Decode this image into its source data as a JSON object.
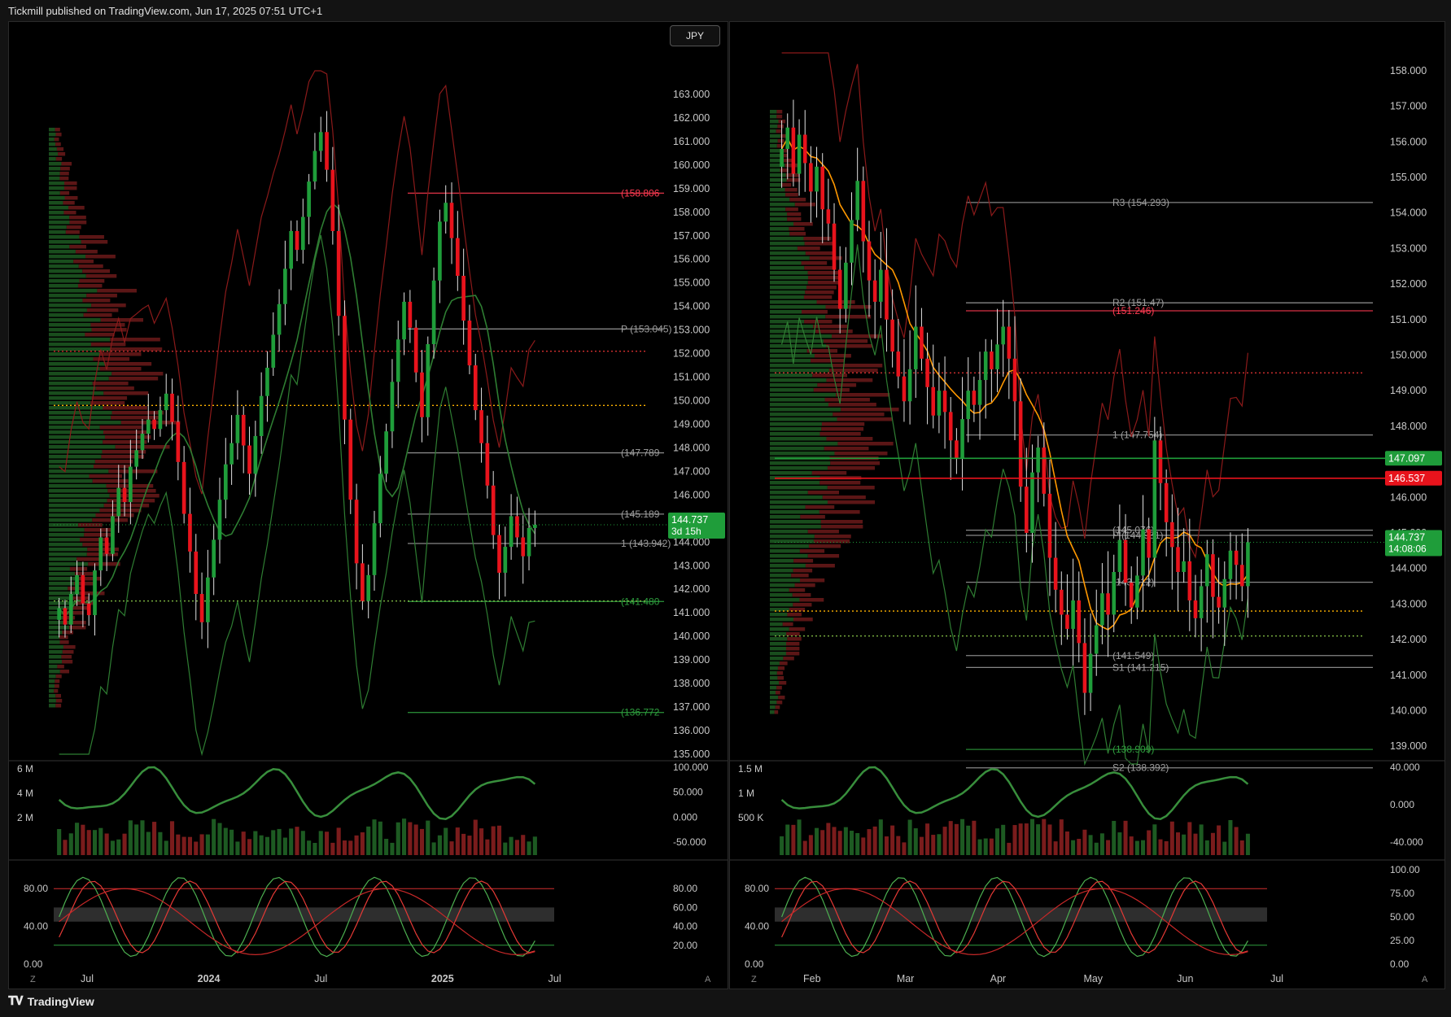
{
  "header": {
    "publisher": "Tickmill published on TradingView.com, Jun 17, 2025 07:51 UTC+1"
  },
  "footer": {
    "brand": "TradingView",
    "logo": "tradingview-logo-icon"
  },
  "colors": {
    "bull": "#1f9d3a",
    "bear": "#e8131c",
    "bg": "#000000",
    "grid_text": "#c8c8c8",
    "orange": "#ff9800"
  },
  "chart_data": [
    {
      "type": "candlestick",
      "panel": "left",
      "symbol_badge": "JPY",
      "price_axis": [
        "163.000",
        "162.000",
        "161.000",
        "160.000",
        "159.000",
        "158.000",
        "157.000",
        "156.000",
        "155.000",
        "154.000",
        "153.000",
        "152.000",
        "151.000",
        "150.000",
        "149.000",
        "148.000",
        "147.000",
        "146.000",
        "145.000",
        "144.000",
        "143.000",
        "142.000",
        "141.000",
        "140.000",
        "139.000",
        "138.000",
        "137.000",
        "136.000",
        "135.000"
      ],
      "ylim": [
        135,
        164
      ],
      "time_axis": [
        "Jul",
        "2024",
        "Jul",
        "2025",
        "Jul"
      ],
      "current_price": "144.737",
      "countdown": "3d 15h",
      "level_labels": [
        {
          "text": "(158.806",
          "value": 158.806,
          "color": "#ff3b52"
        },
        {
          "text": "P (153.045)",
          "value": 153.045,
          "color": "#9e9e9e"
        },
        {
          "text": "(147.789",
          "value": 147.789,
          "color": "#9e9e9e"
        },
        {
          "text": "(145.189",
          "value": 145.189,
          "color": "#9e9e9e"
        },
        {
          "text": "1 (143.942)",
          "value": 143.942,
          "color": "#9e9e9e"
        },
        {
          "text": "(141.480",
          "value": 141.48,
          "color": "#2e9e3e"
        },
        {
          "text": "(136.772",
          "value": 136.772,
          "color": "#2e9e3e"
        }
      ],
      "closes": [
        141.2,
        140.5,
        141.8,
        142.6,
        141.4,
        140.9,
        142.8,
        144.2,
        143.5,
        145.1,
        146.3,
        145.7,
        147.2,
        147.9,
        148.6,
        149.2,
        148.8,
        149.6,
        150.3,
        149.1,
        147.4,
        145.2,
        143.6,
        141.8,
        140.6,
        142.5,
        144.1,
        145.8,
        147.3,
        148.2,
        149.4,
        148.1,
        146.9,
        148.5,
        150.2,
        151.4,
        152.8,
        154.1,
        155.6,
        157.2,
        156.4,
        157.8,
        159.3,
        160.6,
        161.4,
        159.8,
        157.2,
        153.6,
        149.2,
        145.8,
        143.1,
        141.5,
        142.6,
        144.8,
        146.9,
        148.7,
        150.8,
        152.6,
        154.2,
        153.1,
        151.2,
        149.3,
        152.4,
        155.1,
        157.6,
        158.4,
        156.9,
        155.3,
        153.4,
        151.5,
        149.6,
        148.2,
        146.4,
        144.3,
        142.7,
        143.8,
        145.1,
        144.2,
        143.4,
        144.6,
        144.737
      ],
      "volume_axis": [
        "6 M",
        "4 M",
        "2 M"
      ],
      "osc_axis": [
        "100.000",
        "50.000",
        "0.000",
        "-50.000"
      ],
      "stoch_axis_left": [
        "80.00",
        "40.00",
        "0.00"
      ],
      "stoch_axis_right": [
        "80.00",
        "60.00",
        "40.00",
        "20.00"
      ],
      "corner_left": "Z",
      "corner_right": "A"
    },
    {
      "type": "candlestick",
      "panel": "right",
      "price_axis": [
        "158.000",
        "157.000",
        "156.000",
        "155.000",
        "154.000",
        "153.000",
        "152.000",
        "151.000",
        "150.000",
        "149.000",
        "148.000",
        "147.000",
        "146.000",
        "145.000",
        "144.000",
        "143.000",
        "142.000",
        "141.000",
        "140.000",
        "139.000"
      ],
      "ylim": [
        138.5,
        158.5
      ],
      "time_axis": [
        "Feb",
        "Mar",
        "Apr",
        "May",
        "Jun",
        "Jul"
      ],
      "current_price": "144.737",
      "countdown": "14:08:06",
      "price_tags": [
        {
          "text": "147.097",
          "value": 147.097,
          "color": "#1f9d3a"
        },
        {
          "text": "146.537",
          "value": 146.537,
          "color": "#e8131c"
        }
      ],
      "level_labels": [
        {
          "text": "R3 (154.293)",
          "value": 154.293,
          "color": "#9e9e9e"
        },
        {
          "text": "R2 (151.47)",
          "value": 151.47,
          "color": "#9e9e9e"
        },
        {
          "text": "(151.246)",
          "value": 151.246,
          "color": "#ff3b52"
        },
        {
          "text": "1 (147.754)",
          "value": 147.754,
          "color": "#9e9e9e"
        },
        {
          "text": "(145.076)",
          "value": 145.076,
          "color": "#9e9e9e"
        },
        {
          "text": "P (144.931)",
          "value": 144.931,
          "color": "#9e9e9e"
        },
        {
          "text": "(143.612)",
          "value": 143.612,
          "color": "#9e9e9e"
        },
        {
          "text": "(141.549)",
          "value": 141.549,
          "color": "#9e9e9e"
        },
        {
          "text": "S1 (141.215)",
          "value": 141.215,
          "color": "#9e9e9e"
        },
        {
          "text": "(138.909)",
          "value": 138.909,
          "color": "#2e9e3e"
        },
        {
          "text": "S2 (138.392)",
          "value": 138.392,
          "color": "#9e9e9e"
        }
      ],
      "closes": [
        155.8,
        156.4,
        155.1,
        156.2,
        155.4,
        154.6,
        155.3,
        154.1,
        153.7,
        152.4,
        151.3,
        152.6,
        153.8,
        154.9,
        153.2,
        152.1,
        151.5,
        152.4,
        151.0,
        150.1,
        149.4,
        148.7,
        149.6,
        150.8,
        149.9,
        149.1,
        148.3,
        149.0,
        148.4,
        147.6,
        147.1,
        148.2,
        149.0,
        148.6,
        149.3,
        150.1,
        149.6,
        150.3,
        150.8,
        149.9,
        148.7,
        146.3,
        145.0,
        146.7,
        147.4,
        146.1,
        144.3,
        143.4,
        142.7,
        142.3,
        143.1,
        141.9,
        140.5,
        141.6,
        142.4,
        143.3,
        142.7,
        143.9,
        144.8,
        143.6,
        142.9,
        143.8,
        145.1,
        144.3,
        147.6,
        146.4,
        145.3,
        144.6,
        143.9,
        144.2,
        143.1,
        142.6,
        143.5,
        144.4,
        143.2,
        142.9,
        143.7,
        144.5,
        144.1,
        143.5,
        144.737
      ],
      "volume_axis": [
        "1.5 M",
        "1 M",
        "500 K"
      ],
      "osc_axis": [
        "40.000",
        "0.000",
        "-40.000"
      ],
      "stoch_axis_left": [
        "80.00",
        "40.00",
        "0.00"
      ],
      "stoch_axis_right": [
        "100.00",
        "75.00",
        "50.00",
        "25.00",
        "0.00"
      ],
      "corner_left": "Z",
      "corner_right": "A"
    }
  ]
}
